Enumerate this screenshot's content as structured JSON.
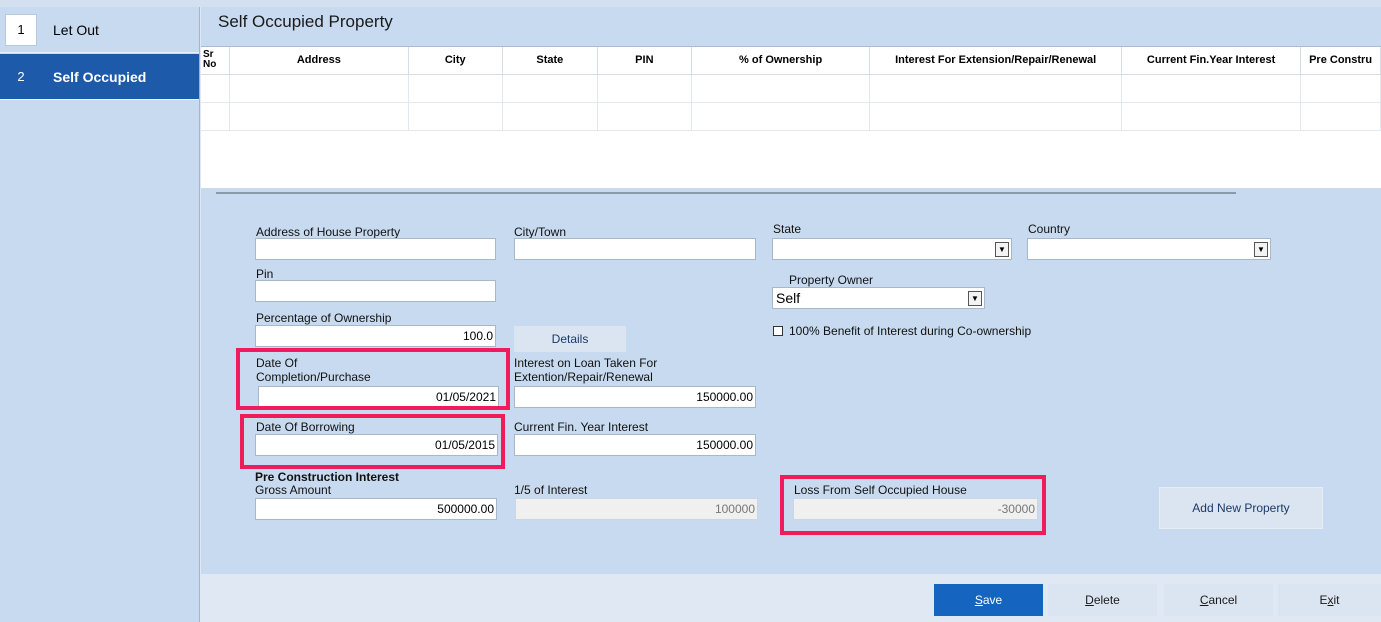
{
  "sidebar": {
    "items": [
      {
        "num": "1",
        "label": "Let Out"
      },
      {
        "num": "2",
        "label": "Self Occupied"
      }
    ]
  },
  "page": {
    "title": "Self Occupied Property"
  },
  "grid": {
    "columns": [
      "Sr No",
      "Address",
      "City",
      "State",
      "PIN",
      "% of Ownership",
      "Interest For Extension/Repair/Renewal",
      "Current Fin.Year Interest",
      "Pre Constru"
    ]
  },
  "form": {
    "address_label": "Address of House Property",
    "address_value": "",
    "city_label": "City/Town",
    "city_value": "",
    "state_label": "State",
    "state_value": "",
    "country_label": "Country",
    "country_value": "",
    "pin_label": "Pin",
    "pin_value": "",
    "owner_label": "Property Owner",
    "owner_value": "Self",
    "pct_label": "Percentage of Ownership",
    "pct_value": "100.0",
    "details_label": "Details",
    "benefit_label": "100% Benefit of Interest during Co-ownership",
    "benefit_checked": false,
    "completion_label_1": "Date Of",
    "completion_label_2": "Completion/Purchase",
    "completion_value": "01/05/2021",
    "loan_label_1": "Interest on Loan Taken For",
    "loan_label_2": "Extention/Repair/Renewal",
    "loan_value": "150000.00",
    "borrow_label": "Date Of Borrowing",
    "borrow_value": "01/05/2015",
    "curint_label": "Current Fin. Year Interest",
    "curint_value": "150000.00",
    "precon_heading": "Pre Construction Interest",
    "gross_label": "Gross Amount",
    "gross_value": "500000.00",
    "fifth_label": "1/5 of Interest",
    "fifth_value": "100000",
    "loss_label": "Loss From Self Occupied House",
    "loss_value": "-30000",
    "add_property_label": "Add New Property"
  },
  "footer": {
    "save_access": "S",
    "save_rest": "ave",
    "delete_access": "D",
    "delete_rest": "elete",
    "cancel_access": "C",
    "cancel_rest": "ancel",
    "exit_pre": "E",
    "exit_access": "x",
    "exit_rest": "it"
  },
  "colors": {
    "accent": "#1565c0",
    "highlight": "#ee1c5a",
    "nav_active": "#1d5aa9",
    "panel": "#c8daef"
  }
}
